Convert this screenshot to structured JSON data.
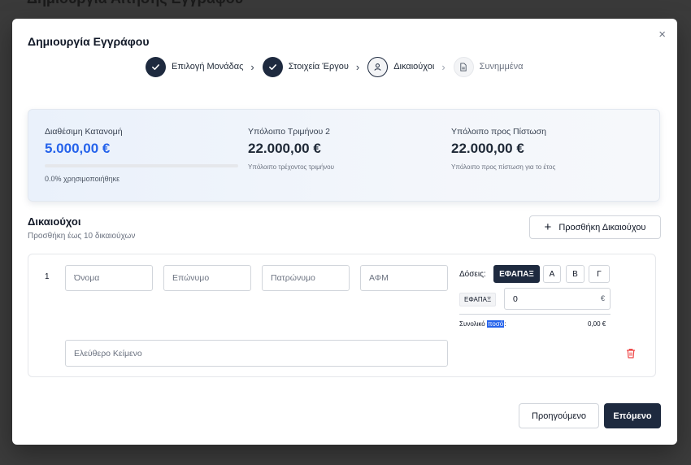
{
  "background": {
    "title": "Δημιουργία Αίτησης Εγγράφου"
  },
  "modal": {
    "title": "Δημιουργία Εγγράφου",
    "close": "×"
  },
  "stepper": [
    {
      "label": "Επιλογή Μονάδας",
      "state": "done",
      "icon": "check-icon"
    },
    {
      "label": "Στοιχεία Έργου",
      "state": "done",
      "icon": "check-icon"
    },
    {
      "label": "Δικαιούχοι",
      "state": "current",
      "icon": "user-icon"
    },
    {
      "label": "Συνημμένα",
      "state": "pending",
      "icon": "file-icon"
    }
  ],
  "summary": {
    "available": {
      "label": "Διαθέσιμη Κατανομή",
      "value": "5.000,00 €",
      "usage_fraction": 0.0,
      "used_text": "0.0% χρησιμοποιήθηκε"
    },
    "quarter": {
      "label": "Υπόλοιπο Τριμήνου 2",
      "value": "22.000,00 €",
      "sub": "Υπόλοιπο τρέχοντος τριμήνου"
    },
    "credit": {
      "label": "Υπόλοιπο προς Πίστωση",
      "value": "22.000,00 €",
      "sub": "Υπόλοιπο προς πίστωση για το έτος"
    }
  },
  "beneficiaries": {
    "title": "Δικαιούχοι",
    "subtitle": "Προσθήκη έως 10 δικαιούχων",
    "add_button": "Προσθήκη Δικαιούχου",
    "rows": [
      {
        "number": "1",
        "placeholders": {
          "first_name": "Όνομα",
          "last_name": "Επώνυμο",
          "father_name": "Πατρώνυμο",
          "afm": "ΑΦΜ",
          "free_text": "Ελεύθερο Κείμενο"
        },
        "doses_label": "Δόσεις:",
        "dose_options": [
          "ΕΦΑΠΑΞ",
          "Α",
          "Β",
          "Γ"
        ],
        "selected_dose": "ΕΦΑΠΑΞ",
        "dose_tag": "ΕΦΑΠΑΞ",
        "amount_value": "0",
        "currency": "€",
        "total_label_prefix": "Συνολικό ",
        "total_label_highlight": "ποσό",
        "total_label_suffix": ":",
        "total_value": "0,00 €"
      }
    ]
  },
  "footer": {
    "prev": "Προηγούμενο",
    "next": "Επόμενο"
  },
  "colors": {
    "primary_dark": "#1e2a3f",
    "accent_blue": "#2563eb",
    "danger": "#ef4444"
  }
}
